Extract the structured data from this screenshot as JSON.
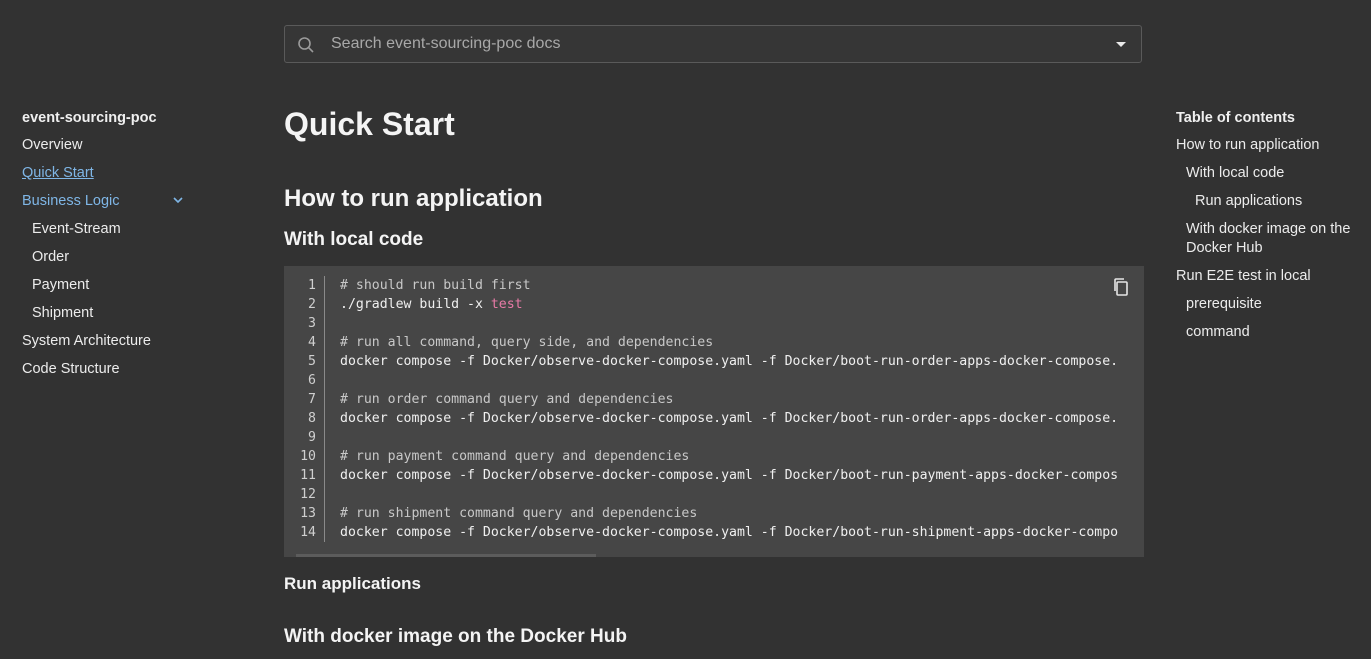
{
  "search": {
    "placeholder": "Search event-sourcing-poc docs"
  },
  "sidebar": {
    "site_title": "event-sourcing-poc",
    "items": [
      {
        "label": "Overview"
      },
      {
        "label": "Quick Start"
      },
      {
        "label": "Business Logic"
      },
      {
        "label": "Event-Stream"
      },
      {
        "label": "Order"
      },
      {
        "label": "Payment"
      },
      {
        "label": "Shipment"
      },
      {
        "label": "System Architecture"
      },
      {
        "label": "Code Structure"
      }
    ]
  },
  "main": {
    "title": "Quick Start",
    "h_run": "How to run application",
    "h_local": "With local code",
    "h_run_apps": "Run applications",
    "h_docker": "With docker image on the Docker Hub",
    "code": {
      "line_numbers": [
        "1",
        "2",
        "3",
        "4",
        "5",
        "6",
        "7",
        "8",
        "9",
        "10",
        "11",
        "12",
        "13",
        "14"
      ],
      "lines": [
        {
          "kind": "comment",
          "text": "# should run build first"
        },
        {
          "kind": "mixed",
          "text": "./gradlew build -x ",
          "kw": "test"
        },
        {
          "kind": "blank",
          "text": ""
        },
        {
          "kind": "comment",
          "text": "# run all command, query side, and dependencies"
        },
        {
          "kind": "code",
          "text": "docker compose -f Docker/observe-docker-compose.yaml -f Docker/boot-run-order-apps-docker-compose."
        },
        {
          "kind": "blank",
          "text": ""
        },
        {
          "kind": "comment",
          "text": "# run order command query and dependencies"
        },
        {
          "kind": "code",
          "text": "docker compose -f Docker/observe-docker-compose.yaml -f Docker/boot-run-order-apps-docker-compose."
        },
        {
          "kind": "blank",
          "text": ""
        },
        {
          "kind": "comment",
          "text": "# run payment command query and dependencies"
        },
        {
          "kind": "code",
          "text": "docker compose -f Docker/observe-docker-compose.yaml -f Docker/boot-run-payment-apps-docker-compos"
        },
        {
          "kind": "blank",
          "text": ""
        },
        {
          "kind": "comment",
          "text": "# run shipment command query and dependencies"
        },
        {
          "kind": "code",
          "text": "docker compose -f Docker/observe-docker-compose.yaml -f Docker/boot-run-shipment-apps-docker-compo"
        }
      ]
    }
  },
  "toc": {
    "title": "Table of contents",
    "items": [
      {
        "label": "How to run application"
      },
      {
        "label": "With local code"
      },
      {
        "label": "Run applications"
      },
      {
        "label": "With docker image on the Docker Hub"
      },
      {
        "label": "Run E2E test in local"
      },
      {
        "label": "prerequisite"
      },
      {
        "label": "command"
      }
    ]
  },
  "colors": {
    "background": "#323232",
    "code_background": "#464646",
    "link_accent": "#7fb6e6",
    "keyword": "#e87aa6"
  }
}
